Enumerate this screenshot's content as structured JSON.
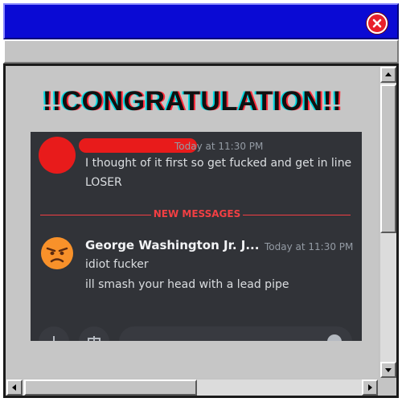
{
  "window": {
    "close_icon": "close-x-icon"
  },
  "popup": {
    "headline": "!!CONGRATULATION!!"
  },
  "chat": {
    "first_message": {
      "timestamp": "Today at 11:30 PM",
      "lines": [
        "I thought of it first so get fucked and get in line",
        "LOSER"
      ]
    },
    "divider_label": "NEW MESSAGES",
    "second_message": {
      "avatar": "angry-face-emoji",
      "username": "George Washington Jr. J...",
      "timestamp": "Today at 11:30 PM",
      "lines": [
        "idiot fucker",
        "ill smash your head with a lead pipe"
      ]
    },
    "colors": {
      "background": "#313338",
      "new_messages": "#f23f43",
      "redaction": "#e81b1b"
    }
  }
}
